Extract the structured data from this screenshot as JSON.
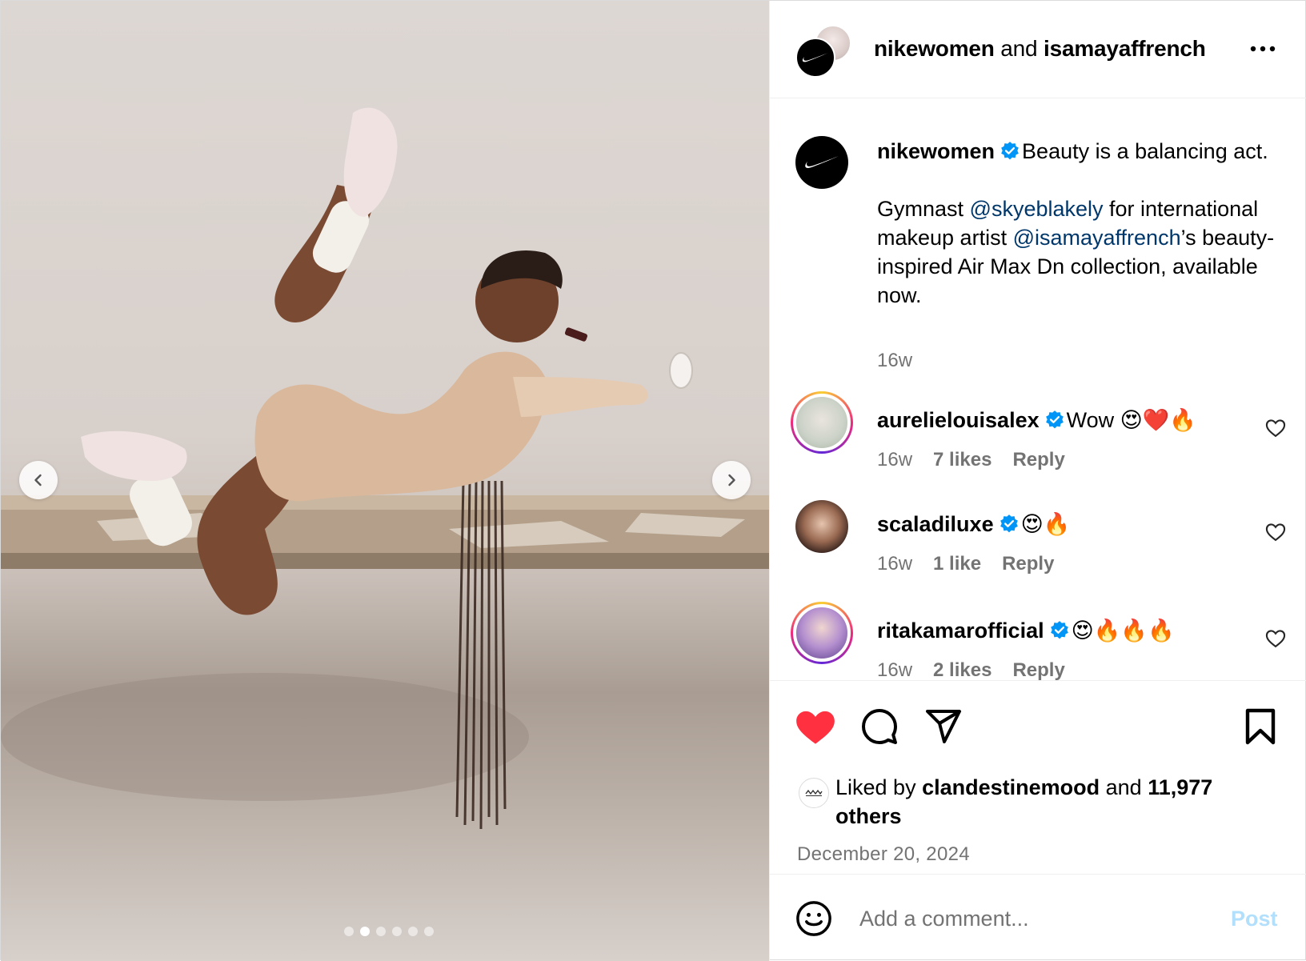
{
  "header": {
    "user1": "nikewomen",
    "conjunction": "and",
    "user2": "isamayaffrench"
  },
  "caption": {
    "username": "nikewomen",
    "line1": "Beauty is a balancing act.",
    "p2_a": "Gymnast ",
    "p2_mention1": "@skyeblakely",
    "p2_b": " for international makeup artist ",
    "p2_mention2": "@isamayaffrench",
    "p2_c": "’s beauty-inspired Air Max Dn collection, available now.",
    "time": "16w"
  },
  "comments": [
    {
      "username": "aurelielouisalex",
      "text": "Wow 😍❤️🔥",
      "time": "16w",
      "likes": "7 likes",
      "reply": "Reply"
    },
    {
      "username": "scaladiluxe",
      "text": "😍🔥",
      "time": "16w",
      "likes": "1 like",
      "reply": "Reply"
    },
    {
      "username": "ritakamarofficial",
      "text": "😍🔥🔥🔥",
      "time": "16w",
      "likes": "2 likes",
      "reply": "Reply"
    }
  ],
  "likes": {
    "prefix": "Liked by ",
    "user": "clandestinemood",
    "middle": " and ",
    "count": "11,977",
    "suffix": " others"
  },
  "date": "December 20, 2024",
  "add_comment": {
    "placeholder": "Add a comment...",
    "post_label": "Post"
  },
  "carousel": {
    "total": 6,
    "active_index": 1
  },
  "colors": {
    "like_red": "#ff3040",
    "link_blue": "#00376b",
    "verified_blue": "#0095f6",
    "post_disabled": "#b2dffc",
    "muted_text": "#737373"
  },
  "icons": [
    "swoosh-icon",
    "more-icon",
    "verified-icon",
    "heart-icon",
    "comment-icon",
    "share-icon",
    "bookmark-icon",
    "emoji-icon",
    "chevron-left-icon",
    "chevron-right-icon"
  ]
}
